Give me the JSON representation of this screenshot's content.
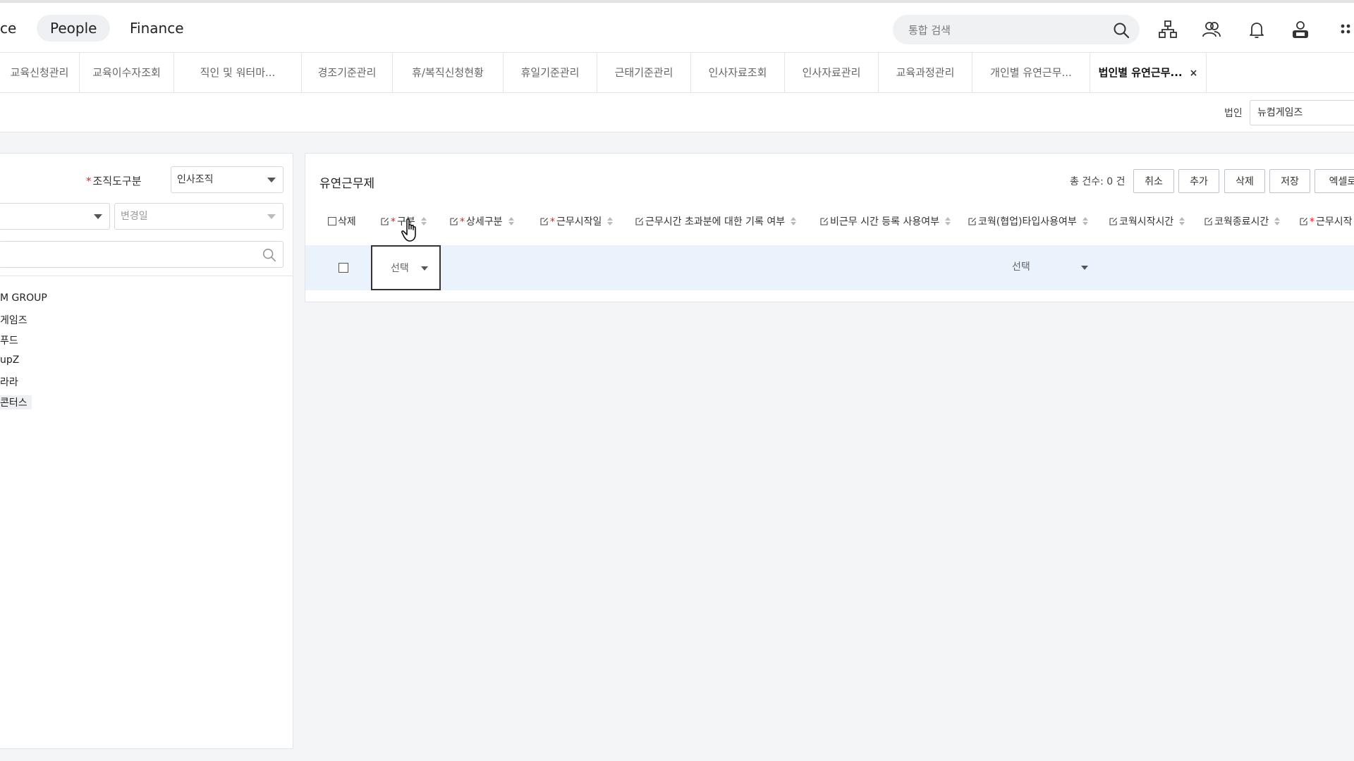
{
  "topnav": {
    "items": [
      {
        "label": "ce",
        "active": false
      },
      {
        "label": "People",
        "active": true
      },
      {
        "label": "Finance",
        "active": false
      }
    ],
    "search": {
      "placeholder": "통합 검색"
    },
    "icons": [
      "org-chart-icon",
      "users-icon",
      "bell-icon",
      "ess-user-icon",
      "apps-grid-icon"
    ]
  },
  "tabs": [
    {
      "label": "교육신청관리"
    },
    {
      "label": "교육이수자조회"
    },
    {
      "label": "직인 및 워터마..."
    },
    {
      "label": "경조기준관리"
    },
    {
      "label": "휴/복직신청현황"
    },
    {
      "label": "휴일기준관리"
    },
    {
      "label": "근태기준관리"
    },
    {
      "label": "인사자료조회"
    },
    {
      "label": "인사자료관리"
    },
    {
      "label": "교육과정관리"
    },
    {
      "label": "개인별 유연근무..."
    },
    {
      "label": "법인별 유연근무...",
      "active": true,
      "close": "×"
    }
  ],
  "filter": {
    "corp_label": "법인",
    "corp_value": "뉴컴게임즈"
  },
  "leftpanel": {
    "org_type_label": "조직도구분",
    "org_type_required": "*",
    "org_type_value": "인사조직",
    "change_date_placeholder": "변경일",
    "tree": [
      {
        "label": "M GROUP"
      },
      {
        "label": "게임즈"
      },
      {
        "label": "푸드"
      },
      {
        "label": "upZ"
      },
      {
        "label": "라라"
      },
      {
        "label": "콘터스",
        "selected": true
      }
    ]
  },
  "main": {
    "title": "유연근무제",
    "total": "총 건수: 0 건",
    "buttons": {
      "cancel": "취소",
      "add": "추가",
      "delete": "삭제",
      "save": "저장",
      "excel": "엑셀로"
    },
    "columns": {
      "delete": "삭제",
      "type": "구분",
      "detail_type": "상세구분",
      "work_start_date": "근무시작일",
      "overtime_record": "근무시간 초과분에 대한 기록 여부",
      "nonwork_register": "비근무 시간 등록 사용여부",
      "cowork_type": "코웍(협업)타입사용여부",
      "cowork_start": "코웍시작시간",
      "cowork_end": "코웍종료시간",
      "work_start": "근무시작"
    },
    "required_mark": "*",
    "row": {
      "type_value": "선택",
      "cowork_type_value": "선택"
    }
  },
  "colors": {
    "accent": "#e02424",
    "row_bg": "#eaf2fb",
    "active_nav_bg": "#eef0f3"
  }
}
